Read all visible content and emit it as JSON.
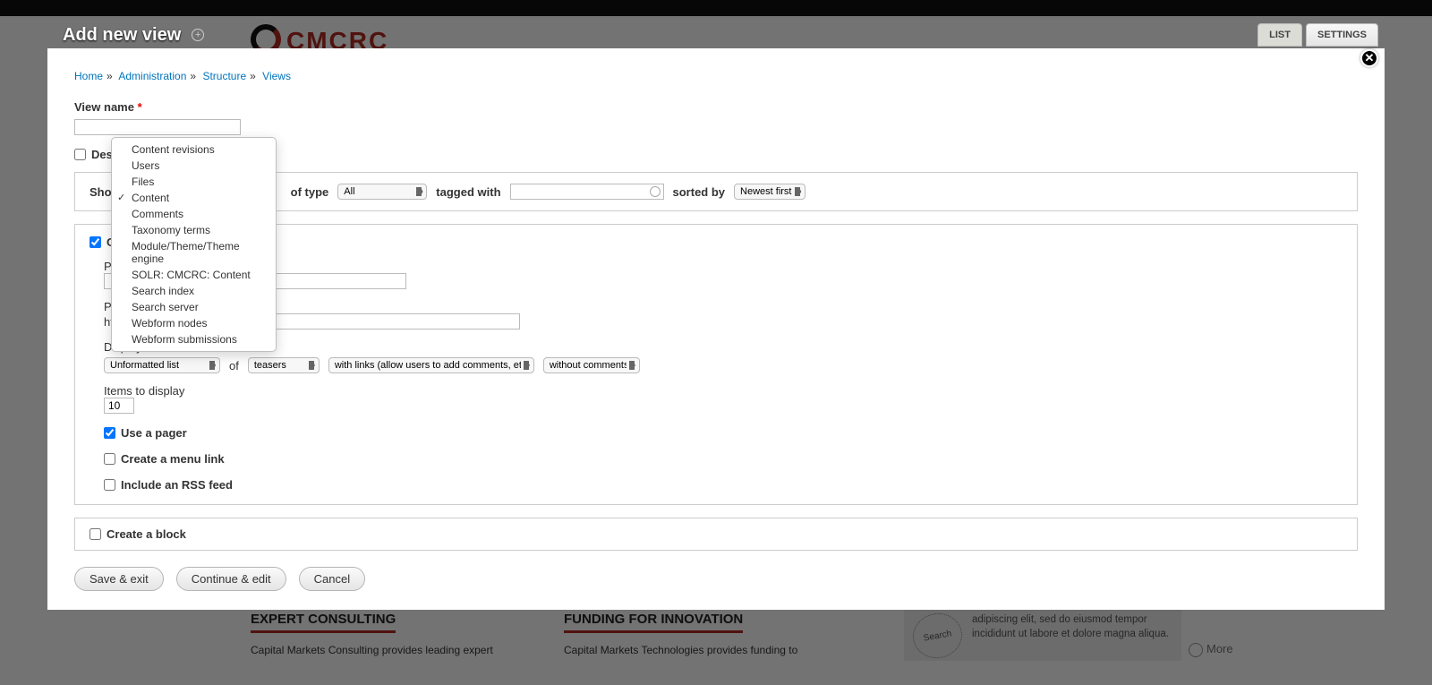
{
  "page": {
    "title": "Add new view",
    "logo": "CMCRC",
    "col1_heading": "EXPERT CONSULTING",
    "col1_text": "Capital Markets Consulting provides leading expert",
    "col2_heading": "FUNDING FOR INNOVATION",
    "col2_text": "Capital Markets Technologies provides funding to",
    "side_text": "adipiscing elit, sed do eiusmod tempor incididunt ut labore et dolore magna aliqua.",
    "side_search": "Search",
    "more": "More"
  },
  "tabs": {
    "list": "LIST",
    "settings": "SETTINGS"
  },
  "breadcrumb": [
    "Home",
    "Administration",
    "Structure",
    "Views"
  ],
  "form": {
    "view_name_label": "View name",
    "view_name_value": "",
    "description_label": "Description",
    "show_label": "Show",
    "of_type_label": "of type",
    "of_type_value": "All",
    "tagged_with_label": "tagged with",
    "tagged_with_value": "",
    "sorted_by_label": "sorted by",
    "sorted_by_value": "Newest first",
    "create_page_label": "Create a page",
    "page_title_label": "Page title",
    "page_title_value": "",
    "path_label": "Path",
    "path_prefix": "http://uat.cmcrc.com/",
    "path_value": "",
    "display_format_label": "Display format",
    "display_format_value": "Unformatted list",
    "of_label": "of",
    "row_style_value": "teasers",
    "links_value": "with links (allow users to add comments, etc.)",
    "comments_value": "without comments",
    "items_label": "Items to display",
    "items_value": "10",
    "use_pager_label": "Use a pager",
    "menu_link_label": "Create a menu link",
    "rss_label": "Include an RSS feed",
    "create_block_label": "Create a block"
  },
  "dropdown_options": [
    {
      "label": "Content revisions",
      "selected": false
    },
    {
      "label": "Users",
      "selected": false
    },
    {
      "label": "Files",
      "selected": false
    },
    {
      "label": "Content",
      "selected": true
    },
    {
      "label": "Comments",
      "selected": false
    },
    {
      "label": "Taxonomy terms",
      "selected": false
    },
    {
      "label": "Module/Theme/Theme engine",
      "selected": false
    },
    {
      "label": "SOLR: CMCRC: Content",
      "selected": false
    },
    {
      "label": "Search index",
      "selected": false
    },
    {
      "label": "Search server",
      "selected": false
    },
    {
      "label": "Webform nodes",
      "selected": false
    },
    {
      "label": "Webform submissions",
      "selected": false
    }
  ],
  "buttons": {
    "save": "Save & exit",
    "continue": "Continue & edit",
    "cancel": "Cancel"
  }
}
